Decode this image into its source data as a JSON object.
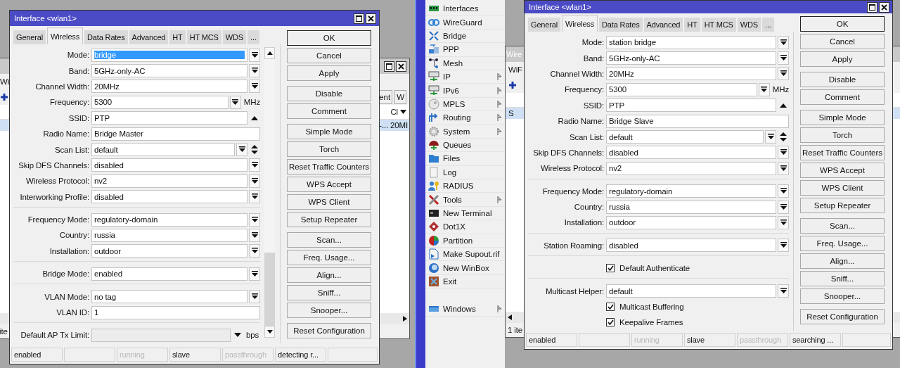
{
  "back_window_left": {
    "tab": "Wi",
    "toolbar_buttons": [
      "ent",
      "W"
    ],
    "column": "Cl",
    "row_cells": [
      "-...",
      "20MI"
    ],
    "status": "ite"
  },
  "back_window_right": {
    "title": "Wire",
    "tab": "WiF",
    "row_cells": [
      "S"
    ],
    "status": "1 ite"
  },
  "sidebar": {
    "items": [
      {
        "label": "Interfaces",
        "has_submenu": false
      },
      {
        "label": "WireGuard",
        "has_submenu": false
      },
      {
        "label": "Bridge",
        "has_submenu": false
      },
      {
        "label": "PPP",
        "has_submenu": false
      },
      {
        "label": "Mesh",
        "has_submenu": false
      },
      {
        "label": "IP",
        "has_submenu": true
      },
      {
        "label": "IPv6",
        "has_submenu": true
      },
      {
        "label": "MPLS",
        "has_submenu": true
      },
      {
        "label": "Routing",
        "has_submenu": true
      },
      {
        "label": "System",
        "has_submenu": true
      },
      {
        "label": "Queues",
        "has_submenu": false
      },
      {
        "label": "Files",
        "has_submenu": false
      },
      {
        "label": "Log",
        "has_submenu": false
      },
      {
        "label": "RADIUS",
        "has_submenu": false
      },
      {
        "label": "Tools",
        "has_submenu": true
      },
      {
        "label": "New Terminal",
        "has_submenu": false
      },
      {
        "label": "Dot1X",
        "has_submenu": false
      },
      {
        "label": "Partition",
        "has_submenu": false
      },
      {
        "label": "Make Supout.rif",
        "has_submenu": false
      },
      {
        "label": "New WinBox",
        "has_submenu": false
      },
      {
        "label": "Exit",
        "has_submenu": false
      }
    ],
    "bottom_items": [
      {
        "label": "Windows",
        "has_submenu": true
      }
    ]
  },
  "dialogs": [
    {
      "title": "Interface <wlan1>",
      "scrollable": true,
      "tabs": [
        {
          "label": "General",
          "selected": false
        },
        {
          "label": "Wireless",
          "selected": true
        },
        {
          "label": "Data Rates",
          "selected": false
        },
        {
          "label": "Advanced",
          "selected": false
        },
        {
          "label": "HT",
          "selected": false
        },
        {
          "label": "HT MCS",
          "selected": false
        },
        {
          "label": "WDS",
          "selected": false
        },
        {
          "label": "...",
          "selected": false
        }
      ],
      "fields": [
        {
          "kind": "dropdown",
          "label": "Mode:",
          "value": "bridge",
          "highlighted": true
        },
        {
          "kind": "dropdown",
          "label": "Band:",
          "value": "5GHz-only-AC",
          "highlighted": false
        },
        {
          "kind": "dropdown",
          "label": "Channel Width:",
          "value": "20MHz",
          "highlighted": false
        },
        {
          "kind": "unit",
          "label": "Frequency:",
          "value": "5300",
          "unit": "MHz",
          "highlighted": false
        },
        {
          "kind": "ssid",
          "label": "SSID:",
          "value": "PTP",
          "highlighted": false
        },
        {
          "kind": "text",
          "label": "Radio Name:",
          "value": "Bridge Master",
          "highlighted": false
        },
        {
          "kind": "scan",
          "label": "Scan List:",
          "value": "default",
          "highlighted": false
        },
        {
          "kind": "dropdown",
          "label": "Skip DFS Channels:",
          "value": "disabled",
          "highlighted": false
        },
        {
          "kind": "dropdown",
          "label": "Wireless Protocol:",
          "value": "nv2",
          "highlighted": false
        },
        {
          "kind": "dropdown",
          "label": "Interworking Profile:",
          "value": "disabled",
          "highlighted": false
        },
        {
          "kind": "separator"
        },
        {
          "kind": "dropdown",
          "label": "Frequency Mode:",
          "value": "regulatory-domain",
          "highlighted": false
        },
        {
          "kind": "dropdown",
          "label": "Country:",
          "value": "russia",
          "highlighted": false
        },
        {
          "kind": "dropdown",
          "label": "Installation:",
          "value": "outdoor",
          "highlighted": false
        },
        {
          "kind": "separator"
        },
        {
          "kind": "dropdown",
          "label": "Bridge Mode:",
          "value": "enabled",
          "highlighted": false
        },
        {
          "kind": "separator"
        },
        {
          "kind": "dropdown",
          "label": "VLAN Mode:",
          "value": "no tag",
          "highlighted": false
        },
        {
          "kind": "text",
          "label": "VLAN ID:",
          "value": "1",
          "highlighted": false
        },
        {
          "kind": "separator"
        },
        {
          "kind": "limit",
          "label": "Default AP Tx Limit:",
          "unit": "bps"
        }
      ],
      "button_groups": [
        [
          "OK",
          "Cancel",
          "Apply"
        ],
        [
          "Disable",
          "Comment"
        ],
        [
          "Simple Mode",
          "Torch",
          "Reset Traffic Counters",
          "WPS Accept",
          "WPS Client",
          "Setup Repeater"
        ],
        [
          "Scan...",
          "Freq. Usage...",
          "Align...",
          "Sniff...",
          "Snooper..."
        ],
        [
          "Reset Configuration"
        ]
      ],
      "status_bar": [
        {
          "kind": "text",
          "text": "enabled",
          "dimmed": false
        },
        {
          "kind": "blank"
        },
        {
          "kind": "text",
          "text": "running",
          "dimmed": true
        },
        {
          "kind": "text",
          "text": "slave",
          "dimmed": false
        },
        {
          "kind": "text",
          "text": "passthrough",
          "dimmed": true
        },
        {
          "kind": "text",
          "text": "detecting r...",
          "dimmed": false
        },
        {
          "kind": "blank"
        }
      ]
    },
    {
      "title": "Interface <wlan1>",
      "scrollable": false,
      "tabs": [
        {
          "label": "General",
          "selected": false
        },
        {
          "label": "Wireless",
          "selected": true
        },
        {
          "label": "Data Rates",
          "selected": false
        },
        {
          "label": "Advanced",
          "selected": false
        },
        {
          "label": "HT",
          "selected": false
        },
        {
          "label": "HT MCS",
          "selected": false
        },
        {
          "label": "WDS",
          "selected": false
        },
        {
          "label": "...",
          "selected": false
        }
      ],
      "fields": [
        {
          "kind": "dropdown",
          "label": "Mode:",
          "value": "station bridge",
          "highlighted": false
        },
        {
          "kind": "dropdown",
          "label": "Band:",
          "value": "5GHz-only-AC",
          "highlighted": false
        },
        {
          "kind": "dropdown",
          "label": "Channel Width:",
          "value": "20MHz",
          "highlighted": false
        },
        {
          "kind": "unit",
          "label": "Frequency:",
          "value": "5300",
          "unit": "MHz",
          "highlighted": false
        },
        {
          "kind": "ssid",
          "label": "SSID:",
          "value": "PTP",
          "highlighted": false
        },
        {
          "kind": "text",
          "label": "Radio Name:",
          "value": "Bridge Slave",
          "highlighted": false
        },
        {
          "kind": "scan",
          "label": "Scan List:",
          "value": "default",
          "highlighted": false
        },
        {
          "kind": "dropdown",
          "label": "Skip DFS Channels:",
          "value": "disabled",
          "highlighted": false
        },
        {
          "kind": "dropdown",
          "label": "Wireless Protocol:",
          "value": "nv2",
          "highlighted": false
        },
        {
          "kind": "separator"
        },
        {
          "kind": "dropdown",
          "label": "Frequency Mode:",
          "value": "regulatory-domain",
          "highlighted": false
        },
        {
          "kind": "dropdown",
          "label": "Country:",
          "value": "russia",
          "highlighted": false
        },
        {
          "kind": "dropdown",
          "label": "Installation:",
          "value": "outdoor",
          "highlighted": false
        },
        {
          "kind": "separator"
        },
        {
          "kind": "dropdown",
          "label": "Station Roaming:",
          "value": "disabled",
          "highlighted": false
        },
        {
          "kind": "separator"
        },
        {
          "kind": "checkbox",
          "label": "Default Authenticate",
          "checked": true
        },
        {
          "kind": "separator"
        },
        {
          "kind": "dropdown",
          "label": "Multicast Helper:",
          "value": "default",
          "highlighted": false
        },
        {
          "kind": "checkbox",
          "label": "Multicast Buffering",
          "checked": true
        },
        {
          "kind": "checkbox",
          "label": "Keepalive Frames",
          "checked": true
        }
      ],
      "button_groups": [
        [
          "OK",
          "Cancel",
          "Apply"
        ],
        [
          "Disable",
          "Comment"
        ],
        [
          "Simple Mode",
          "Torch",
          "Reset Traffic Counters",
          "WPS Accept",
          "WPS Client",
          "Setup Repeater"
        ],
        [
          "Scan...",
          "Freq. Usage...",
          "Align...",
          "Sniff...",
          "Snooper..."
        ],
        [
          "Reset Configuration"
        ]
      ],
      "status_bar": [
        {
          "kind": "text",
          "text": "enabled",
          "dimmed": false
        },
        {
          "kind": "blank"
        },
        {
          "kind": "text",
          "text": "running",
          "dimmed": true
        },
        {
          "kind": "text",
          "text": "slave",
          "dimmed": false
        },
        {
          "kind": "text",
          "text": "passthrough",
          "dimmed": true
        },
        {
          "kind": "text",
          "text": "searching ...",
          "dimmed": false
        },
        {
          "kind": "blank"
        }
      ]
    }
  ]
}
